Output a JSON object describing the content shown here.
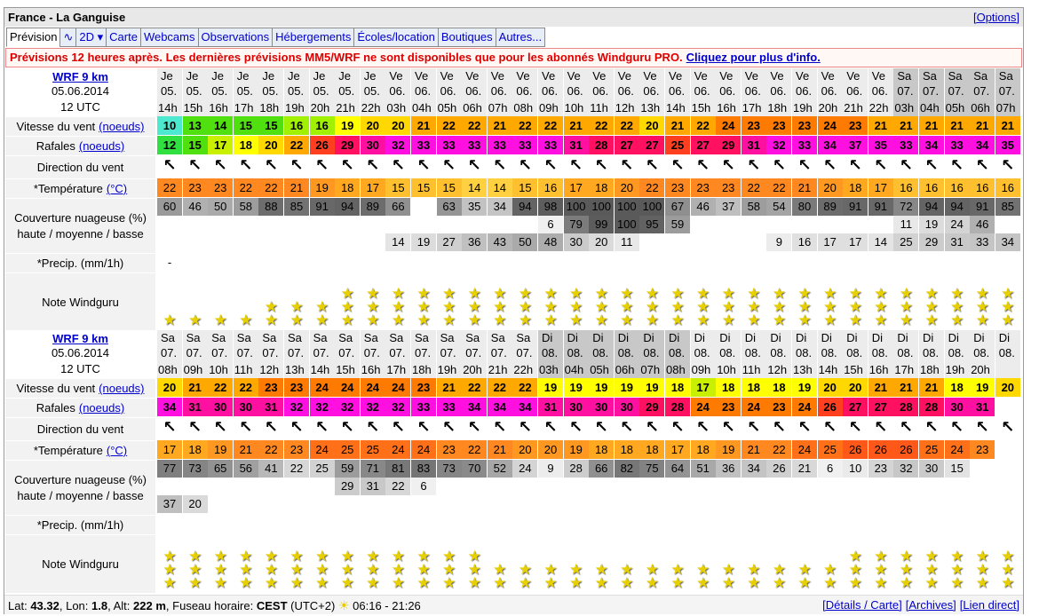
{
  "title": "France - La Ganguise",
  "options": "[Options]",
  "tabs": [
    "Prévision",
    "∿",
    "2D ▾",
    "Carte",
    "Webcams",
    "Observations",
    "Hébergements",
    "Écoles/location",
    "Boutiques",
    "Autres..."
  ],
  "banner": {
    "text": "Prévisions 12 heures après. Les dernières prévisions MM5/WRF ne sont disponibles que pour les abonnés Windguru PRO.",
    "link": "Cliquez pour plus d'info."
  },
  "labels": {
    "model": "WRF 9 km",
    "wind": "Vitesse du vent",
    "gust": "Rafales",
    "unit": "(noeuds)",
    "dir": "Direction du vent",
    "temp": "*Température",
    "temp_unit": "(°C)",
    "cloud": "Couverture nuageuse (%) haute / moyenne / basse",
    "precip": "*Precip. (mm/1h)",
    "rating": "Note Windguru"
  },
  "sections": [
    {
      "date": "05.06.2014",
      "utc": "12 UTC",
      "days": [
        "Je 05.",
        "Je 05.",
        "Je 05.",
        "Je 05.",
        "Je 05.",
        "Je 05.",
        "Je 05.",
        "Je 05.",
        "Je 05.",
        "Ve 06.",
        "Ve 06.",
        "Ve 06.",
        "Ve 06.",
        "Ve 06.",
        "Ve 06.",
        "Ve 06.",
        "Ve 06.",
        "Ve 06.",
        "Ve 06.",
        "Ve 06.",
        "Ve 06.",
        "Ve 06.",
        "Ve 06.",
        "Ve 06.",
        "Ve 06.",
        "Ve 06.",
        "Ve 06.",
        "Ve 06.",
        "Ve 06.",
        "Sa 07.",
        "Sa 07.",
        "Sa 07.",
        "Sa 07.",
        "Sa 07."
      ],
      "hours": [
        "14h",
        "15h",
        "16h",
        "17h",
        "18h",
        "19h",
        "20h",
        "21h",
        "22h",
        "03h",
        "04h",
        "05h",
        "06h",
        "07h",
        "08h",
        "09h",
        "10h",
        "11h",
        "12h",
        "13h",
        "14h",
        "15h",
        "16h",
        "17h",
        "18h",
        "19h",
        "20h",
        "21h",
        "22h",
        "03h",
        "04h",
        "05h",
        "06h",
        "07h"
      ],
      "dark": [
        0,
        0,
        0,
        0,
        0,
        0,
        0,
        0,
        0,
        0,
        0,
        0,
        0,
        0,
        0,
        0,
        0,
        0,
        0,
        0,
        0,
        0,
        0,
        0,
        0,
        0,
        0,
        0,
        0,
        1,
        1,
        1,
        1,
        1
      ],
      "wind": [
        10,
        13,
        14,
        15,
        15,
        16,
        16,
        19,
        20,
        20,
        21,
        22,
        22,
        21,
        22,
        22,
        21,
        22,
        22,
        20,
        21,
        22,
        24,
        23,
        23,
        23,
        24,
        23,
        21,
        21,
        21,
        21,
        21,
        21
      ],
      "gust": [
        12,
        15,
        17,
        18,
        20,
        22,
        26,
        29,
        30,
        32,
        33,
        33,
        33,
        33,
        33,
        33,
        31,
        28,
        27,
        27,
        25,
        27,
        29,
        31,
        32,
        33,
        34,
        37,
        35,
        33,
        34,
        33,
        34,
        35
      ],
      "temp": [
        22,
        23,
        23,
        22,
        22,
        21,
        19,
        18,
        17,
        15,
        15,
        15,
        14,
        14,
        15,
        16,
        17,
        18,
        20,
        22,
        23,
        23,
        23,
        22,
        22,
        21,
        20,
        18,
        17,
        16,
        16,
        16,
        16,
        16
      ],
      "cloud_high": [
        "60",
        "46",
        "50",
        "58",
        "88",
        "85",
        "91",
        "94",
        "89",
        "66",
        "",
        "63",
        "35",
        "34",
        "94",
        "98",
        "100",
        "100",
        "100",
        "100",
        "67",
        "46",
        "37",
        "58",
        "54",
        "80",
        "89",
        "91",
        "91",
        "72",
        "94",
        "94",
        "91",
        "85"
      ],
      "cloud_mid": [
        "",
        "",
        "",
        "",
        "",
        "",
        "",
        "",
        "",
        "",
        "",
        "",
        "",
        "",
        "",
        "6",
        "79",
        "99",
        "100",
        "95",
        "59",
        "",
        "",
        "",
        "",
        "",
        "",
        "",
        "",
        "11",
        "19",
        "24",
        "46",
        ""
      ],
      "cloud_low": [
        "",
        "",
        "",
        "",
        "",
        "",
        "",
        "",
        "",
        "14",
        "19",
        "27",
        "36",
        "43",
        "50",
        "48",
        "30",
        "20",
        "11",
        "",
        "",
        "",
        "",
        "",
        "9",
        "16",
        "17",
        "17",
        "14",
        "25",
        "29",
        "31",
        "33",
        "34"
      ],
      "precip": [
        "-",
        "",
        "",
        "",
        "",
        "",
        "",
        "",
        "",
        "",
        "",
        "",
        "",
        "",
        "",
        "",
        "",
        "",
        "",
        "",
        "",
        "",
        "",
        "",
        "",
        "",
        "",
        "",
        "",
        "",
        "",
        "",
        "",
        ""
      ],
      "stars": [
        1,
        1,
        1,
        1,
        2,
        2,
        2,
        3,
        3,
        3,
        3,
        3,
        3,
        3,
        3,
        3,
        3,
        3,
        3,
        3,
        3,
        3,
        3,
        3,
        3,
        3,
        3,
        3,
        3,
        3,
        3,
        3,
        3,
        3
      ]
    },
    {
      "date": "05.06.2014",
      "utc": "12 UTC",
      "days": [
        "Sa 07.",
        "Sa 07.",
        "Sa 07.",
        "Sa 07.",
        "Sa 07.",
        "Sa 07.",
        "Sa 07.",
        "Sa 07.",
        "Sa 07.",
        "Sa 07.",
        "Sa 07.",
        "Sa 07.",
        "Sa 07.",
        "Sa 07.",
        "Sa 07.",
        "Di 08.",
        "Di 08.",
        "Di 08.",
        "Di 08.",
        "Di 08.",
        "Di 08.",
        "Di 08.",
        "Di 08.",
        "Di 08.",
        "Di 08.",
        "Di 08.",
        "Di 08.",
        "Di 08.",
        "Di 08.",
        "Di 08.",
        "Di 08.",
        "Di 08.",
        "Di 08.",
        "Di 08."
      ],
      "hours": [
        "08h",
        "09h",
        "10h",
        "11h",
        "12h",
        "13h",
        "14h",
        "15h",
        "16h",
        "17h",
        "18h",
        "19h",
        "20h",
        "21h",
        "22h",
        "03h",
        "04h",
        "05h",
        "06h",
        "07h",
        "08h",
        "09h",
        "10h",
        "11h",
        "12h",
        "13h",
        "14h",
        "15h",
        "16h",
        "17h",
        "18h",
        "19h",
        "20h",
        ""
      ],
      "dark": [
        0,
        0,
        0,
        0,
        0,
        0,
        0,
        0,
        0,
        0,
        0,
        0,
        0,
        0,
        0,
        1,
        1,
        1,
        1,
        1,
        1,
        0,
        0,
        0,
        0,
        0,
        0,
        0,
        0,
        0,
        0,
        0,
        0,
        0
      ],
      "wind": [
        20,
        21,
        22,
        22,
        23,
        23,
        24,
        24,
        24,
        24,
        23,
        21,
        22,
        22,
        22,
        19,
        19,
        19,
        19,
        19,
        18,
        17,
        18,
        18,
        18,
        19,
        20,
        20,
        21,
        21,
        21,
        18,
        19,
        20
      ],
      "gust": [
        34,
        31,
        30,
        30,
        31,
        32,
        32,
        32,
        32,
        32,
        33,
        33,
        34,
        34,
        34,
        31,
        30,
        30,
        30,
        29,
        28,
        24,
        23,
        24,
        23,
        24,
        26,
        27,
        27,
        28,
        28,
        30,
        31,
        ""
      ],
      "temp": [
        17,
        18,
        19,
        21,
        22,
        23,
        24,
        25,
        25,
        24,
        24,
        23,
        22,
        21,
        20,
        20,
        19,
        18,
        18,
        18,
        17,
        18,
        19,
        21,
        22,
        24,
        25,
        26,
        26,
        26,
        25,
        24,
        23,
        ""
      ],
      "cloud_high": [
        "77",
        "73",
        "65",
        "56",
        "41",
        "22",
        "25",
        "59",
        "71",
        "81",
        "83",
        "73",
        "70",
        "52",
        "24",
        "9",
        "28",
        "66",
        "82",
        "75",
        "64",
        "51",
        "36",
        "34",
        "26",
        "21",
        "6",
        "10",
        "23",
        "32",
        "30",
        "15",
        "",
        ""
      ],
      "cloud_mid": [
        "",
        "",
        "",
        "",
        "",
        "",
        "",
        "29",
        "31",
        "22",
        "6",
        "",
        "",
        "",
        "",
        "",
        "",
        "",
        "",
        "",
        "",
        "",
        "",
        "",
        "",
        "",
        "",
        "",
        "",
        "",
        "",
        "",
        "",
        ""
      ],
      "cloud_low": [
        "37",
        "20",
        "",
        "",
        "",
        "",
        "",
        "",
        "",
        "",
        "",
        "",
        "",
        "",
        "",
        "",
        "",
        "",
        "",
        "",
        "",
        "",
        "",
        "",
        "",
        "",
        "",
        "",
        "",
        "",
        "",
        "",
        "",
        ""
      ],
      "precip": [
        "",
        "",
        "",
        "",
        "",
        "",
        "",
        "",
        "",
        "",
        "",
        "",
        "",
        "",
        "",
        "",
        "",
        "",
        "",
        "",
        "",
        "",
        "",
        "",
        "",
        "",
        "",
        "",
        "",
        "",
        "",
        "",
        "",
        ""
      ],
      "stars": [
        3,
        3,
        3,
        3,
        3,
        3,
        3,
        3,
        3,
        3,
        3,
        3,
        3,
        2,
        2,
        2,
        2,
        2,
        2,
        2,
        2,
        2,
        2,
        2,
        2,
        2,
        2,
        3,
        3,
        3,
        3,
        3,
        3,
        3
      ]
    }
  ],
  "footer": {
    "lat_label": "Lat:",
    "lat": "43.32",
    "lon_label": "Lon:",
    "lon": "1.8",
    "alt_label": "Alt:",
    "alt": "222 m",
    "tz_label": "Fuseau horaire:",
    "tz": "CEST",
    "tz_offset": "(UTC+2)",
    "sun": "06:16 - 21:26",
    "links": [
      "[Détails / Carte]",
      "[Archives]",
      "[Lien direct]"
    ]
  },
  "colors": {
    "wind_scale": "green-yellow-orange-red-magenta",
    "temp_scale": "orange",
    "cloud": "gray"
  }
}
